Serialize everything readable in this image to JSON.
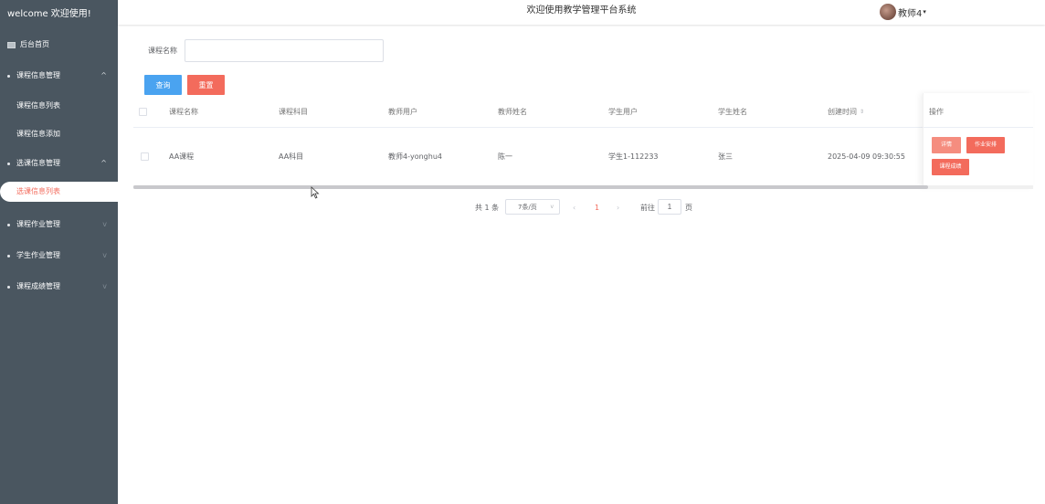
{
  "sidebar": {
    "brand": "welcome 欢迎使用!",
    "home": "后台首页",
    "groups": [
      {
        "label": "课程信息管理",
        "items": [
          "课程信息列表",
          "课程信息添加"
        ]
      },
      {
        "label": "选课信息管理",
        "items": [
          "选课信息列表"
        ]
      },
      {
        "label": "课程作业管理"
      },
      {
        "label": "学生作业管理"
      },
      {
        "label": "课程成绩管理"
      }
    ]
  },
  "header": {
    "title": "欢迎使用教学管理平台系统",
    "user": "教师4"
  },
  "search": {
    "label": "课程名称",
    "value": "",
    "query_button": "查询",
    "reset_button": "重置"
  },
  "table": {
    "columns": [
      "课程名称",
      "课程科目",
      "教师用户",
      "教师姓名",
      "学生用户",
      "学生姓名",
      "创建时间",
      "操作"
    ],
    "rows": [
      {
        "course_name": "AA课程",
        "subject": "AA科目",
        "teacher_user": "教师4-yonghu4",
        "teacher_name": "陈一",
        "student_user": "学生1-112233",
        "student_name": "张三",
        "created": "2025-04-09 09:30:55"
      }
    ],
    "actions": [
      "详情",
      "作业安排",
      "课程成绩"
    ]
  },
  "pagination": {
    "total": "共 1 条",
    "page_size": "7条/页",
    "prev": "‹",
    "current": "1",
    "next": "›",
    "goto": "前往",
    "goto_value": "1",
    "page_suffix": "页"
  },
  "colors": {
    "sidebar_bg": "#4a5660",
    "accent_red": "#f36b5c",
    "query_blue": "#4aa3f0"
  }
}
